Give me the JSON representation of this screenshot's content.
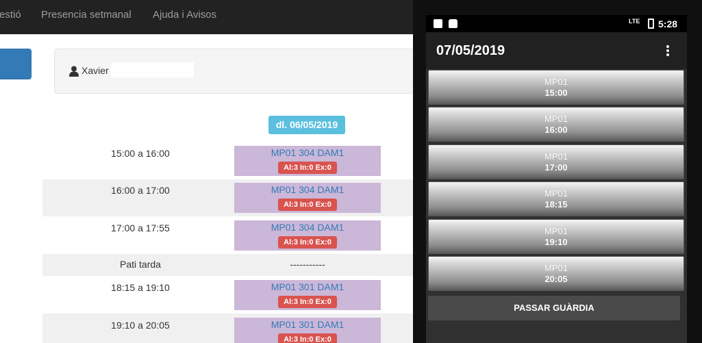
{
  "navbar": {
    "items": [
      "estió",
      "Presencia setmanal",
      "Ajuda i Avisos"
    ]
  },
  "user": {
    "name": "Xavier"
  },
  "schedule": {
    "date": "dl. 06/05/2019",
    "rows": [
      {
        "time": "15:00 a 16:00",
        "subject": "MP01 304 DAM1",
        "badge": "Al:3 In:0 Ex:0"
      },
      {
        "time": "16:00 a 17:00",
        "subject": "MP01 304 DAM1",
        "badge": "Al:3 In:0 Ex:0"
      },
      {
        "time": "17:00 a 17:55",
        "subject": "MP01 304 DAM1",
        "badge": "Al:3 In:0 Ex:0"
      },
      {
        "time": "Pati tarda",
        "subject": "-----------"
      },
      {
        "time": "18:15 a 19:10",
        "subject": "MP01 301 DAM1",
        "badge": "Al:3 In:0 Ex:0"
      },
      {
        "time": "19:10 a 20:05",
        "subject": "MP01 301 DAM1",
        "badge": "Al:3 In:0 Ex:0"
      }
    ]
  },
  "phone": {
    "status": {
      "network": "LTE",
      "time": "5:28"
    },
    "app_title": "07/05/2019",
    "classes": [
      {
        "subject": "MP01",
        "time": "15:00"
      },
      {
        "subject": "MP01",
        "time": "16:00"
      },
      {
        "subject": "MP01",
        "time": "17:00"
      },
      {
        "subject": "MP01",
        "time": "18:15"
      },
      {
        "subject": "MP01",
        "time": "19:10"
      },
      {
        "subject": "MP01",
        "time": "20:05"
      }
    ],
    "guard_button": "PASSAR GUÀRDIA"
  },
  "colors": {
    "navbar": "#222222",
    "primary": "#337ab7",
    "info": "#5bc0de",
    "danger": "#d9534f",
    "slot": "#cbb7d8"
  },
  "icons": {
    "user": "user-icon",
    "menu": "overflow-menu-icon",
    "battery": "battery-icon",
    "signal": "signal-icon"
  }
}
